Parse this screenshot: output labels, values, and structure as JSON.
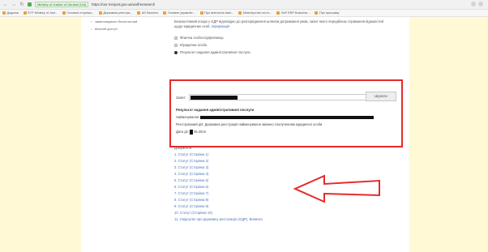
{
  "browser": {
    "url_badge": "Ministry of Justice of Ukraine [UA]",
    "url": "https://usr.minjust.gov.ua/ua/freesearch",
    "bookmarks": [
      "Додатки",
      "ЕГР Ministry of Just...",
      "Головна сторінка...",
      "Державна реєстра...",
      "AD Banners",
      "Головне управлін...",
      "Про внесення змін...",
      "Міністерство юсти...",
      "SAP ERP Business...",
      "Про програму"
    ]
  },
  "sidebar": {
    "items": [
      "завантажувати безоплатний",
      "вільний доступ"
    ]
  },
  "main": {
    "intro_text": "Безкоштовний пошук у ЄДР відповідно до розпорядження шляхом дотримання умов, запит якого передбачає отримання відомостей щодо юридичних особ.",
    "intro_link": "Інформація"
  },
  "options": [
    {
      "label": "Фізична особа-підприємець",
      "checked": false
    },
    {
      "label": "Юридична особа",
      "checked": false
    },
    {
      "label": "Результат надання адміністративної послуги",
      "checked": true
    }
  ],
  "result": {
    "query_label": "Запит:",
    "search_button": "Шукати",
    "title": "Результат надання адміністративної послуги",
    "applicant_label": "Найменування:",
    "reason_label": "Реєстрований дія:",
    "reason_text": "Державна реєстрація найменування змінено сполученням юридичної особи",
    "date_label": "Дата дії:",
    "date_suffix": "05.2016"
  },
  "documents": {
    "title": "Документи:",
    "items": [
      "1. Статут (Сторінка 1)",
      "2. Статут (Сторінка 2)",
      "3. Статут (Сторінка 3)",
      "4. Статут (Сторінка 4)",
      "5. Статут (Сторінка 5)",
      "6. Статут (Сторінка 6)",
      "7. Статут (Сторінка 7)",
      "8. Статут (Сторінка 8)",
      "9. Статут (Сторінка 9)",
      "10. Статут (Сторінка 10)",
      "11. Свідоцтво про державну реєстрацію (ЄДР), Виписка"
    ]
  },
  "colors": {
    "highlight_red": "#e32b2b",
    "page_background": "#fff9d6",
    "link_blue": "#4a74b7"
  }
}
